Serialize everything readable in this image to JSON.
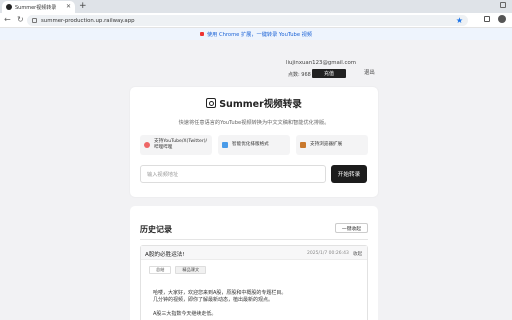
{
  "browser": {
    "tab_title": "Summer视频转录",
    "url": "summer-production.up.railway.app"
  },
  "banner": {
    "text": "使用 Chrome 扩展，一键转录 YouTube 视频"
  },
  "user": {
    "email": "liujinxuan123@gmail.com",
    "points_label": "点数: 968",
    "recharge_label": "充值",
    "logout_label": "退出"
  },
  "main": {
    "app_title": "Summer视频转录",
    "subtitle": "快速将任意语言的YouTube视频转换为中文文稿和智能优化排版。",
    "features": [
      {
        "icon": "pin-icon",
        "text_line1": "支持YouTube/X(Twitter)/",
        "text_line2": "哔哩哔哩"
      },
      {
        "icon": "doc-icon",
        "text_line1": "智能优化排版格式",
        "text_line2": ""
      },
      {
        "icon": "puzzle-icon",
        "text_line1": "支持浏览器扩展",
        "text_line2": ""
      }
    ],
    "input_placeholder": "输入视频地址",
    "start_label": "开始转录"
  },
  "history": {
    "title": "历史记录",
    "clear_label": "一键收起",
    "records": [
      {
        "title": "A股的必胜运法!",
        "time": "2025/1/7 00:26:43",
        "collapse_label": "收起",
        "tabs": [
          "总结",
          "精品课文"
        ],
        "lines": [
          "哈喽，大家好，欢迎您来到A股，原股和中概股的专题栏目。",
          "几分钟的视频，即你了解最新动态，植出最新的观点。",
          "",
          "A股三大指数今天继续走低。"
        ]
      }
    ]
  },
  "colors": {
    "accent_dark": "#1c1c1c",
    "banner_blue": "#1a62d6",
    "bookmark_star": "#1a73e8"
  }
}
